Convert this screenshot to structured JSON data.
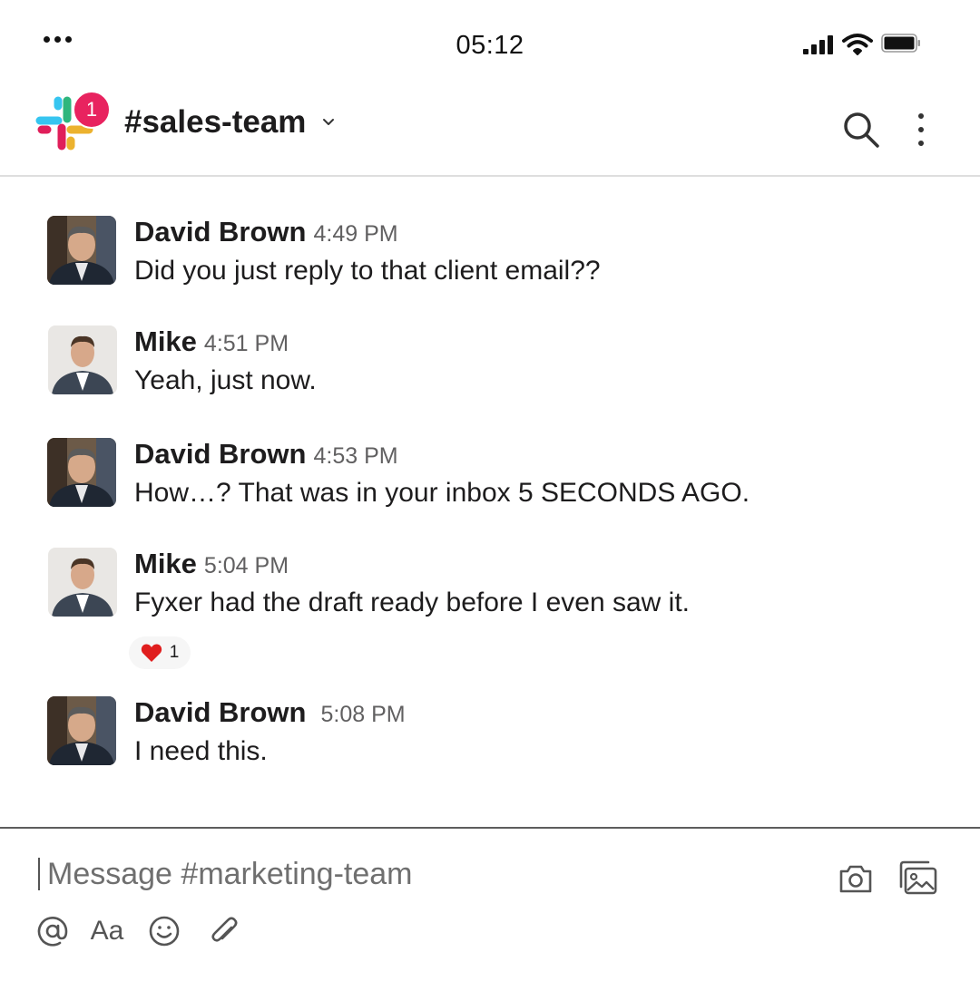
{
  "status_bar": {
    "time": "05:12",
    "icons": [
      "more-dots-icon",
      "cellular-signal-icon",
      "wifi-icon",
      "battery-icon"
    ]
  },
  "header": {
    "workspace_logo": "slack-logo",
    "notification_count": "1",
    "channel_name": "#sales-team",
    "icons": [
      "chevron-down-icon",
      "search-icon",
      "more-vertical-icon"
    ]
  },
  "messages": [
    {
      "author": "David Brown",
      "time": "4:49 PM",
      "text": "Did you just reply to that client email??"
    },
    {
      "author": "Mike",
      "time": "4:51 PM",
      "text": "Yeah, just now."
    },
    {
      "author": "David Brown",
      "time": "4:53 PM",
      "text": "How…?  That was in your inbox 5 SECONDS AGO."
    },
    {
      "author": "Mike",
      "time": "5:04 PM",
      "text": "Fyxer had the draft ready before I even saw it.",
      "reaction": {
        "emoji": "heart",
        "count": "1"
      }
    },
    {
      "author": "David Brown",
      "time": "5:08 PM",
      "text": "I need this."
    }
  ],
  "composer": {
    "placeholder": "Message #marketing-team",
    "value": "",
    "format_label": "Aa",
    "icons": [
      "camera-icon",
      "gallery-icon",
      "at-mention-icon",
      "emoji-icon",
      "attachment-icon"
    ]
  },
  "colors": {
    "notification_badge": "#e8235f",
    "reaction_heart": "#e01e1e",
    "timestamp": "#616061",
    "text": "#1d1c1d",
    "slack_blue": "#36c5f0",
    "slack_green": "#2eb67d",
    "slack_red": "#e01e5a",
    "slack_yellow": "#ecb22e"
  }
}
